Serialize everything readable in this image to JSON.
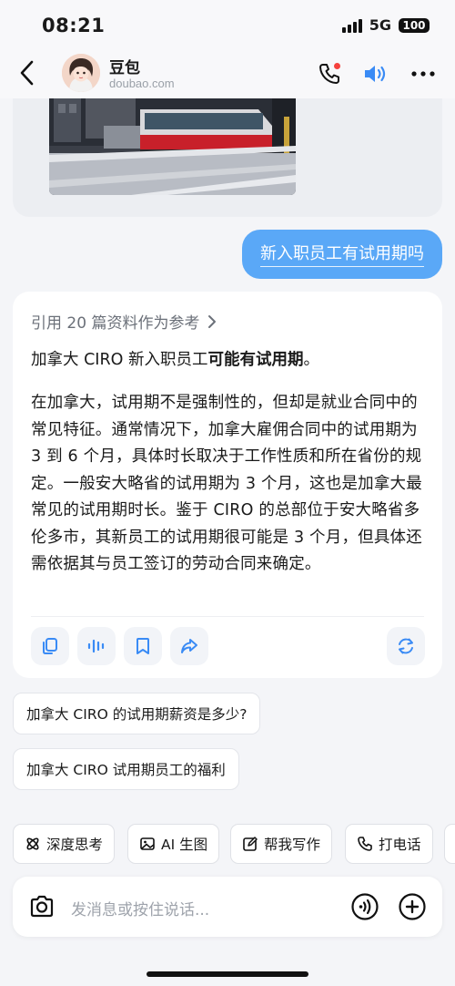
{
  "status": {
    "time": "08:21",
    "network": "5G",
    "battery": "100"
  },
  "header": {
    "back_icon": "chevron-left-icon",
    "bot_name": "豆包",
    "bot_site": "doubao.com",
    "actions": [
      "phone-call-icon",
      "speaker-icon",
      "more-icon"
    ],
    "accent_color": "#3a8bf5",
    "notify_dot_color": "#f5413d"
  },
  "chat": {
    "user_message": "新入职员工有试用期吗",
    "user_bubble_color": "#5aa8f7",
    "reference_text": "引用 20 篇资料作为参考",
    "answer_lead_prefix": "加拿大 CIRO 新入职员工",
    "answer_lead_bold": "可能有试用期",
    "answer_lead_suffix": "。",
    "answer_body": "在加拿大，试用期不是强制性的，但却是就业合同中的常见特征。通常情况下，加拿大雇佣合同中的试用期为 3 到 6 个月，具体时长取决于工作性质和所在省份的规定。一般安大略省的试用期为 3 个月，这也是加拿大最常见的试用期时长。鉴于 CIRO 的总部位于安大略省多伦多市，其新员工的试用期很可能是 3 个月，但具体还需依据其与员工签订的劳动合同来确定。",
    "answer_actions": [
      "copy-icon",
      "voice-wave-icon",
      "bookmark-icon",
      "share-icon",
      "regenerate-icon"
    ]
  },
  "suggestions": [
    "加拿大 CIRO 的试用期薪资是多少?",
    "加拿大 CIRO 试用期员工的福利"
  ],
  "tools": [
    {
      "icon": "deep-think-icon",
      "label": "深度思考"
    },
    {
      "icon": "image-gen-icon",
      "label": "AI 生图"
    },
    {
      "icon": "write-icon",
      "label": "帮我写作"
    },
    {
      "icon": "phone-icon",
      "label": "打电话"
    }
  ],
  "input": {
    "placeholder": "发消息或按住说话...",
    "left_icon": "camera-icon",
    "right_icons": [
      "voice-input-icon",
      "plus-icon"
    ]
  }
}
